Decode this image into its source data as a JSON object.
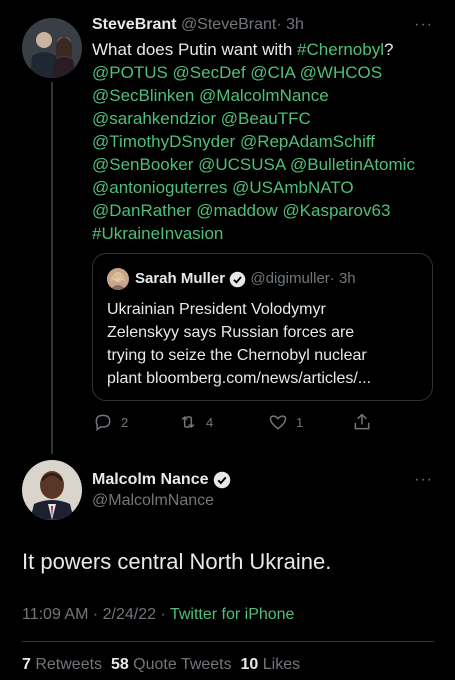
{
  "tweet1": {
    "author_name": "SteveBrant",
    "author_handle": "@SteveBrant",
    "time": "· 3h",
    "more": "···",
    "text_intro": "What does Putin want with ",
    "text_hashtag1": "#Chernobyl",
    "text_q": "?",
    "mention_lines": [
      "@POTUS @SecDef @CIA @WHCOS",
      "@SecBlinken @MalcolmNance",
      "@sarahkendzior @BeauTFC",
      "@TimothyDSnyder @RepAdamSchiff",
      "@SenBooker @UCSUSA @BulletinAtomic",
      "@antonioguterres @USAmbNATO",
      "@DanRather @maddow @Kasparov63",
      "#UkraineInvasion"
    ],
    "quote": {
      "author_name": "Sarah Muller",
      "author_handle": "@digimuller",
      "time": "· 3h",
      "lines": [
        "Ukrainian President Volodymyr",
        "Zelenskyy says Russian forces are",
        "trying to seize the Chernobyl nuclear",
        "plant bloomberg.com/news/articles/..."
      ]
    },
    "actions": {
      "replies": "2",
      "retweets": "4",
      "likes": "1"
    }
  },
  "tweet2": {
    "author_name": "Malcolm Nance",
    "author_handle": "@MalcolmNance",
    "more": "···",
    "text": "It powers central North Ukraine.",
    "timestamp": "11:09 AM · 2/24/22 · ",
    "source": "Twitter for iPhone",
    "stats": {
      "retweets_count": "7",
      "retweets_label": " Retweets",
      "quotes_count": "58",
      "quotes_label": " Quote Tweets",
      "likes_count": "10",
      "likes_label": " Likes"
    }
  },
  "colors": {
    "background": "#000000",
    "text": "#e7e9ea",
    "muted": "#71767b",
    "link": "#4fbf7a",
    "verified": "#1d9bf0"
  }
}
